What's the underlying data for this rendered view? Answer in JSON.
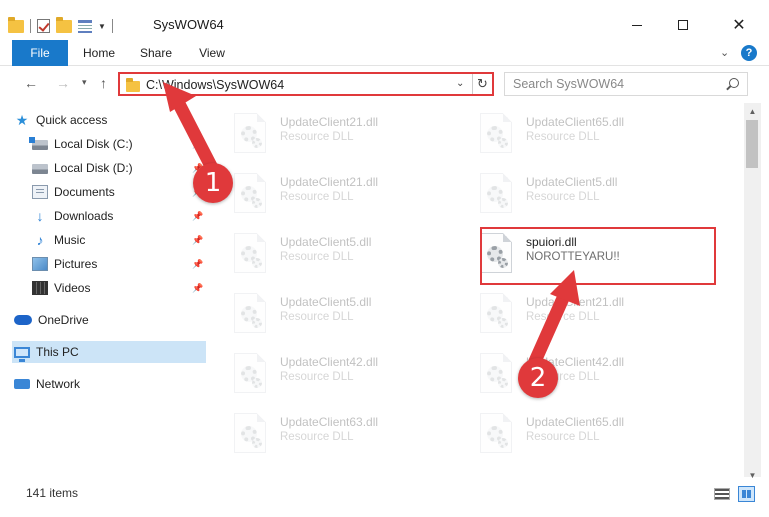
{
  "window": {
    "title": "SysWOW64",
    "minimize_icon": "minimize-icon",
    "maximize_icon": "maximize-icon",
    "close_glyph": "✕"
  },
  "ribbon": {
    "tabs": [
      {
        "label": "File"
      },
      {
        "label": "Home"
      },
      {
        "label": "Share"
      },
      {
        "label": "View"
      }
    ],
    "help_glyph": "?",
    "expand_glyph": "⌄"
  },
  "nav": {
    "back_glyph": "←",
    "forward_glyph": "→",
    "recent_glyph": "▾",
    "up_glyph": "↑",
    "address": "C:\\Windows\\SysWOW64",
    "address_dropdown": "⌄",
    "refresh_glyph": "↻",
    "search_placeholder": "Search SysWOW64"
  },
  "sidebar": {
    "items": [
      {
        "label": "Quick access",
        "icon": "star-icon"
      },
      {
        "label": "Local Disk (C:)",
        "icon": "drive-icon"
      },
      {
        "label": "Local Disk (D:)",
        "icon": "drive-icon"
      },
      {
        "label": "Documents",
        "icon": "documents-icon"
      },
      {
        "label": "Downloads",
        "icon": "download-icon"
      },
      {
        "label": "Music",
        "icon": "music-icon"
      },
      {
        "label": "Pictures",
        "icon": "pictures-icon"
      },
      {
        "label": "Videos",
        "icon": "videos-icon"
      },
      {
        "label": "OneDrive",
        "icon": "cloud-icon"
      },
      {
        "label": "This PC",
        "icon": "computer-icon"
      },
      {
        "label": "Network",
        "icon": "network-icon"
      }
    ],
    "star_glyph": "★",
    "download_glyph": "↓",
    "music_glyph": "♪"
  },
  "files": [
    {
      "name": "UpdateClient21.dll",
      "desc": "Resource DLL"
    },
    {
      "name": "UpdateClient65.dll",
      "desc": "Resource DLL"
    },
    {
      "name": "UpdateClient21.dll",
      "desc": "Resource DLL"
    },
    {
      "name": "UpdateClient5.dll",
      "desc": "Resource DLL"
    },
    {
      "name": "UpdateClient5.dll",
      "desc": "Resource DLL"
    },
    {
      "name": "spuiori.dll",
      "desc": "NOROTTEYARU!!"
    },
    {
      "name": "UpdateClient5.dll",
      "desc": "Resource DLL"
    },
    {
      "name": "UpdateClient21.dll",
      "desc": "Resource DLL"
    },
    {
      "name": "UpdateClient42.dll",
      "desc": "Resource DLL"
    },
    {
      "name": "UpdateClient42.dll",
      "desc": "Resource DLL"
    },
    {
      "name": "UpdateClient63.dll",
      "desc": "Resource DLL"
    },
    {
      "name": "UpdateClient65.dll",
      "desc": "Resource DLL"
    }
  ],
  "annotations": {
    "step1": "1",
    "step2": "2",
    "color": "#e0393b"
  },
  "status": {
    "count_text": "141 items"
  },
  "scroll": {
    "up_glyph": "▲",
    "down_glyph": "▼"
  },
  "colors": {
    "accent": "#1979ca",
    "selected": "#cce4f7",
    "highlight": "#e0393b"
  }
}
